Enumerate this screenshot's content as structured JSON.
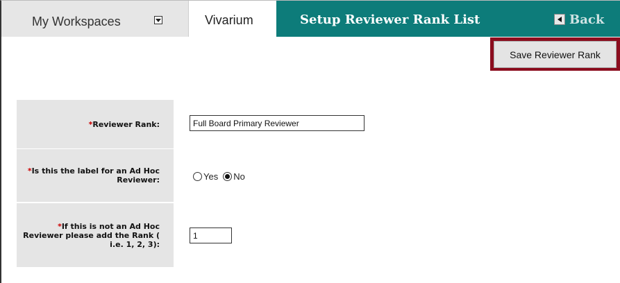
{
  "header": {
    "workspaces_label": "My Workspaces",
    "active_tab": "Vivarium",
    "title": "Setup Reviewer Rank List",
    "back_label": "Back"
  },
  "toolbar": {
    "save_label": "Save Reviewer Rank"
  },
  "form": {
    "required_marker": "*",
    "reviewer_rank": {
      "label": "Reviewer Rank:",
      "value": "Full Board Primary Reviewer"
    },
    "ad_hoc": {
      "label": "Is this the label for an Ad Hoc Reviewer:",
      "options": [
        "Yes",
        "No"
      ],
      "selected": "No"
    },
    "rank_number": {
      "label": "If this is not an Ad Hoc Reviewer please add the Rank ( i.e. 1, 2, 3):",
      "value": "1"
    }
  },
  "colors": {
    "header_teal": "#0d7c7a",
    "save_highlight": "#8b0d1e",
    "required": "#cc0000"
  }
}
